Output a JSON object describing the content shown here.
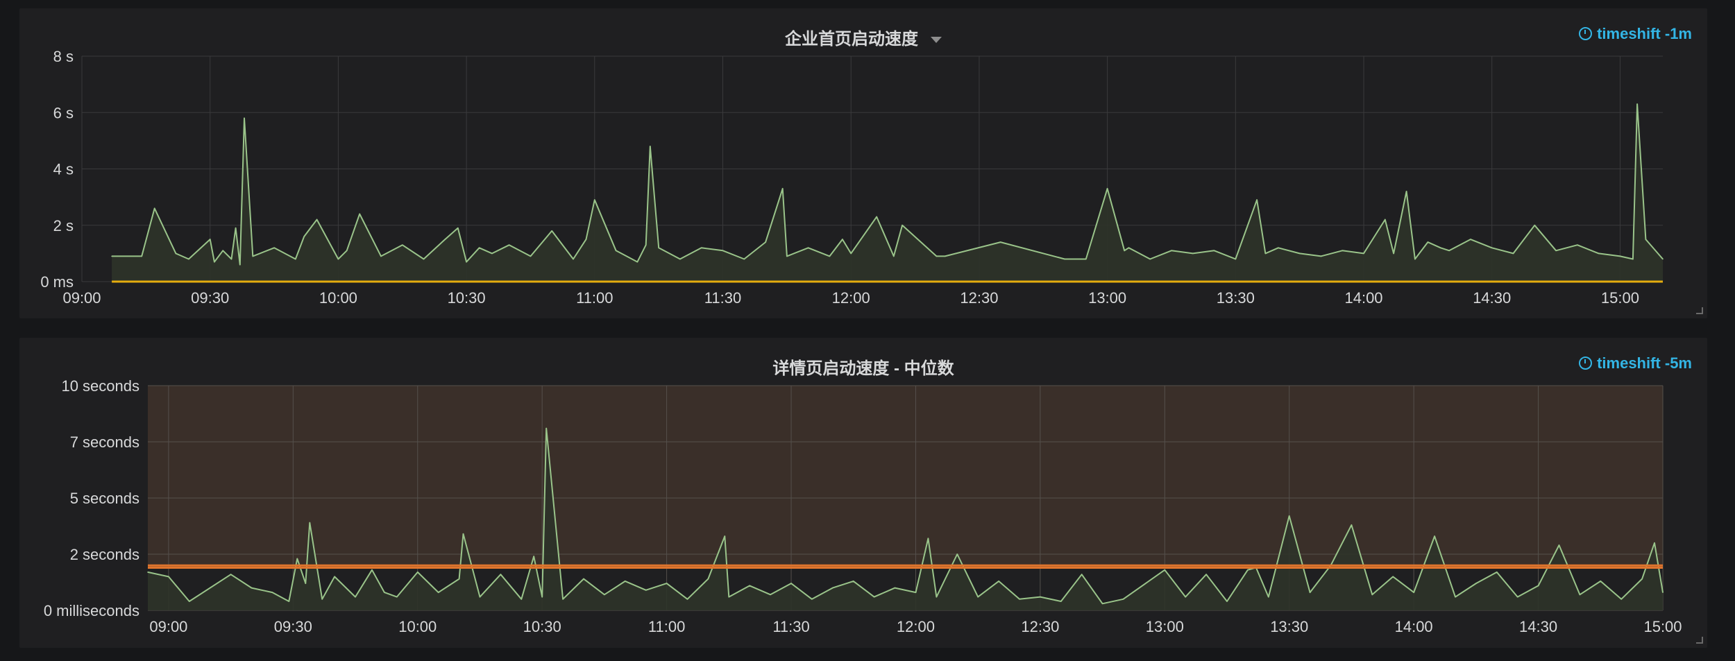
{
  "panels": [
    {
      "title": "企业首页启动速度",
      "timeshift": "timeshift -1m",
      "colors": {
        "line": "#9ac48a",
        "fill": "#2d3329",
        "threshold": "#e5ac0e",
        "grid": "#3a3a3c",
        "text": "#d8d9da"
      }
    },
    {
      "title": "详情页启动速度 - 中位数",
      "timeshift": "timeshift -5m",
      "colors": {
        "line": "#9ac48a",
        "fill": "#2d3329",
        "threshold": "#e0752d",
        "band": "#3a2f29",
        "grid": "#55504c",
        "text": "#d8d9da"
      }
    }
  ],
  "chart_data": [
    {
      "type": "line",
      "title": "企业首页启动速度",
      "x_range": [
        "09:00",
        "15:10"
      ],
      "ylim": [
        0,
        8
      ],
      "y_unit": "s",
      "y_ticks": [
        "0 ms",
        "2 s",
        "4 s",
        "6 s",
        "8 s"
      ],
      "x_ticks": [
        "09:00",
        "09:30",
        "10:00",
        "10:30",
        "11:00",
        "11:30",
        "12:00",
        "12:30",
        "13:00",
        "13:30",
        "14:00",
        "14:30",
        "15:00"
      ],
      "grid": true,
      "series": [
        {
          "x": [
            "09:07",
            "09:14",
            "09:17",
            "09:22",
            "09:25",
            "09:30",
            "09:31",
            "09:33",
            "09:35",
            "09:36",
            "09:37",
            "09:38",
            "09:40",
            "09:45",
            "09:50",
            "09:52",
            "09:55",
            "10:00",
            "10:02",
            "10:05",
            "10:10",
            "10:15",
            "10:20",
            "10:25",
            "10:28",
            "10:30",
            "10:33",
            "10:36",
            "10:40",
            "10:45",
            "10:50",
            "10:55",
            "10:58",
            "11:00",
            "11:05",
            "11:10",
            "11:12",
            "11:13",
            "11:15",
            "11:20",
            "11:25",
            "11:30",
            "11:35",
            "11:40",
            "11:44",
            "11:45",
            "11:50",
            "11:55",
            "11:58",
            "12:00",
            "12:06",
            "12:10",
            "12:12",
            "12:20",
            "12:22",
            "12:35",
            "12:50",
            "12:55",
            "13:00",
            "13:04",
            "13:05",
            "13:10",
            "13:15",
            "13:20",
            "13:25",
            "13:30",
            "13:35",
            "13:37",
            "13:40",
            "13:45",
            "13:50",
            "13:55",
            "14:00",
            "14:05",
            "14:07",
            "14:10",
            "14:12",
            "14:15",
            "14:18",
            "14:20",
            "14:25",
            "14:30",
            "14:35",
            "14:40",
            "14:45",
            "14:50",
            "14:55",
            "15:00",
            "15:03",
            "15:04",
            "15:06",
            "15:10"
          ],
          "y": [
            0.9,
            0.9,
            2.6,
            1.0,
            0.8,
            1.5,
            0.7,
            1.1,
            0.8,
            1.9,
            0.6,
            5.8,
            0.9,
            1.2,
            0.8,
            1.6,
            2.2,
            0.8,
            1.1,
            2.4,
            0.9,
            1.3,
            0.8,
            1.5,
            1.9,
            0.7,
            1.2,
            1.0,
            1.3,
            0.9,
            1.8,
            0.8,
            1.5,
            2.9,
            1.1,
            0.7,
            1.3,
            4.8,
            1.2,
            0.8,
            1.2,
            1.1,
            0.8,
            1.4,
            3.3,
            0.9,
            1.2,
            0.9,
            1.5,
            1.0,
            2.3,
            0.9,
            2.0,
            0.9,
            0.9,
            1.4,
            0.8,
            0.8,
            3.3,
            1.1,
            1.2,
            0.8,
            1.1,
            1.0,
            1.1,
            0.8,
            2.9,
            1.0,
            1.2,
            1.0,
            0.9,
            1.1,
            1.0,
            2.2,
            1.0,
            3.2,
            0.8,
            1.4,
            1.2,
            1.1,
            1.5,
            1.2,
            1.0,
            2.0,
            1.1,
            1.3,
            1.0,
            0.9,
            0.8,
            6.3,
            1.5,
            0.8
          ]
        }
      ],
      "thresholds": [
        0
      ]
    },
    {
      "type": "line",
      "title": "详情页启动速度 - 中位数",
      "x_range": [
        "08:55",
        "15:00"
      ],
      "ylim": [
        0,
        10
      ],
      "y_unit": "seconds",
      "y_ticks": [
        "0 milliseconds",
        "2 seconds",
        "5 seconds",
        "7 seconds",
        "10 seconds"
      ],
      "x_ticks": [
        "09:00",
        "09:30",
        "10:00",
        "10:30",
        "11:00",
        "11:30",
        "12:00",
        "12:30",
        "13:00",
        "13:30",
        "14:00",
        "14:30",
        "15:00"
      ],
      "grid": true,
      "series": [
        {
          "x": [
            "08:55",
            "09:00",
            "09:05",
            "09:15",
            "09:20",
            "09:25",
            "09:29",
            "09:31",
            "09:33",
            "09:34",
            "09:37",
            "09:40",
            "09:45",
            "09:49",
            "09:52",
            "09:55",
            "10:00",
            "10:05",
            "10:10",
            "10:11",
            "10:15",
            "10:20",
            "10:25",
            "10:28",
            "10:30",
            "10:31",
            "10:35",
            "10:40",
            "10:45",
            "10:50",
            "10:55",
            "11:00",
            "11:05",
            "11:10",
            "11:14",
            "11:15",
            "11:20",
            "11:25",
            "11:30",
            "11:35",
            "11:40",
            "11:45",
            "11:50",
            "11:55",
            "12:00",
            "12:03",
            "12:05",
            "12:10",
            "12:15",
            "12:20",
            "12:25",
            "12:30",
            "12:35",
            "12:40",
            "12:45",
            "12:50",
            "13:00",
            "13:05",
            "13:10",
            "13:15",
            "13:20",
            "13:22",
            "13:25",
            "13:30",
            "13:35",
            "13:40",
            "13:45",
            "13:50",
            "13:55",
            "14:00",
            "14:05",
            "14:10",
            "14:15",
            "14:20",
            "14:25",
            "14:30",
            "14:35",
            "14:40",
            "14:45",
            "14:50",
            "14:55",
            "14:58",
            "15:00"
          ],
          "y": [
            1.7,
            1.5,
            0.4,
            1.6,
            1.0,
            0.8,
            0.4,
            2.3,
            1.2,
            3.9,
            0.5,
            1.5,
            0.6,
            1.8,
            0.8,
            0.6,
            1.7,
            0.8,
            1.4,
            3.4,
            0.6,
            1.6,
            0.5,
            2.4,
            0.6,
            8.1,
            0.5,
            1.4,
            0.7,
            1.3,
            0.9,
            1.2,
            0.5,
            1.4,
            3.3,
            0.6,
            1.1,
            0.7,
            1.2,
            0.5,
            1.0,
            1.3,
            0.6,
            1.0,
            0.8,
            3.2,
            0.6,
            2.5,
            0.6,
            1.3,
            0.5,
            0.6,
            0.4,
            1.6,
            0.3,
            0.5,
            1.8,
            0.6,
            1.6,
            0.4,
            1.8,
            1.9,
            0.6,
            4.2,
            0.8,
            2.0,
            3.8,
            0.7,
            1.5,
            0.8,
            3.3,
            0.6,
            1.2,
            1.7,
            0.6,
            1.1,
            2.9,
            0.7,
            1.3,
            0.5,
            1.4,
            3.0,
            0.8
          ]
        }
      ],
      "thresholds": [
        1.9,
        2.0
      ]
    }
  ]
}
